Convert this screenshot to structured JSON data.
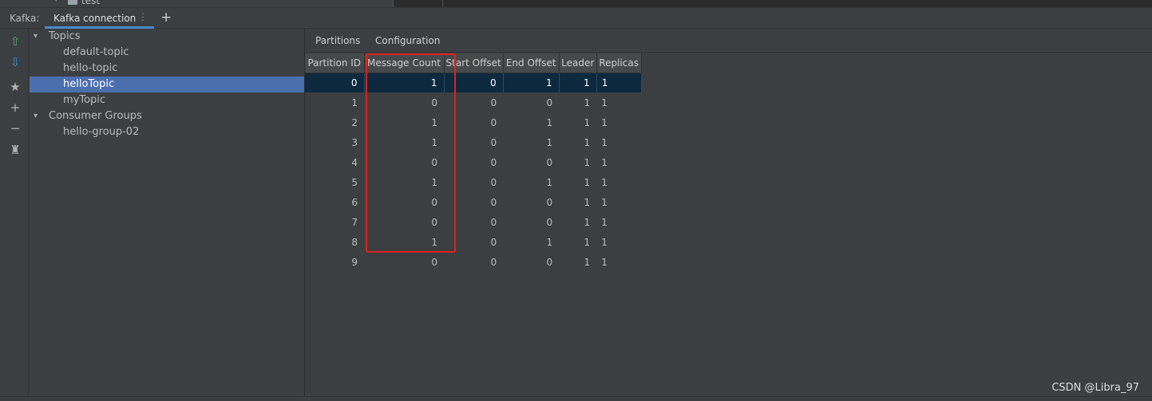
{
  "top": {
    "tree_text": "test"
  },
  "header": {
    "label": "Kafka:",
    "tab_label": "Kafka connection",
    "tab_menu_glyph": "⋮",
    "add_glyph": "+"
  },
  "toolbar": [
    {
      "name": "export-icon",
      "glyph": "⇧",
      "color": "#59a869"
    },
    {
      "name": "import-icon",
      "glyph": "⇩",
      "color": "#3592c4"
    },
    {
      "name": "favorite-star-icon",
      "glyph": "★",
      "color": "#afb1b3"
    },
    {
      "name": "add-icon",
      "glyph": "+",
      "color": "#afb1b3"
    },
    {
      "name": "remove-icon",
      "glyph": "−",
      "color": "#afb1b3"
    },
    {
      "name": "clean-broom-icon",
      "glyph": "♜",
      "color": "#afb1b3"
    }
  ],
  "tree": {
    "topics_label": "Topics",
    "topics": [
      "default-topic",
      "hello-topic",
      "helloTopic",
      "myTopic"
    ],
    "selected_topic": "helloTopic",
    "groups_label": "Consumer Groups",
    "groups": [
      "hello-group-02"
    ]
  },
  "subtabs": [
    "Partitions",
    "Configuration"
  ],
  "table": {
    "columns": [
      "Partition ID",
      "Message Count",
      "Start Offset",
      "End Offset",
      "Leader",
      "Replicas"
    ],
    "rows": [
      [
        "0",
        "1",
        "0",
        "1",
        "1",
        "1"
      ],
      [
        "1",
        "0",
        "0",
        "0",
        "1",
        "1"
      ],
      [
        "2",
        "1",
        "0",
        "1",
        "1",
        "1"
      ],
      [
        "3",
        "1",
        "0",
        "1",
        "1",
        "1"
      ],
      [
        "4",
        "0",
        "0",
        "0",
        "1",
        "1"
      ],
      [
        "5",
        "1",
        "0",
        "1",
        "1",
        "1"
      ],
      [
        "6",
        "0",
        "0",
        "0",
        "1",
        "1"
      ],
      [
        "7",
        "0",
        "0",
        "0",
        "1",
        "1"
      ],
      [
        "8",
        "1",
        "0",
        "1",
        "1",
        "1"
      ],
      [
        "9",
        "0",
        "0",
        "0",
        "1",
        "1"
      ]
    ],
    "selected_row": 0
  },
  "colors": {
    "accent": "#4a88c7",
    "selection": "#4b6eaf",
    "annotation": "#e02020"
  },
  "watermark": "CSDN @Libra_97"
}
